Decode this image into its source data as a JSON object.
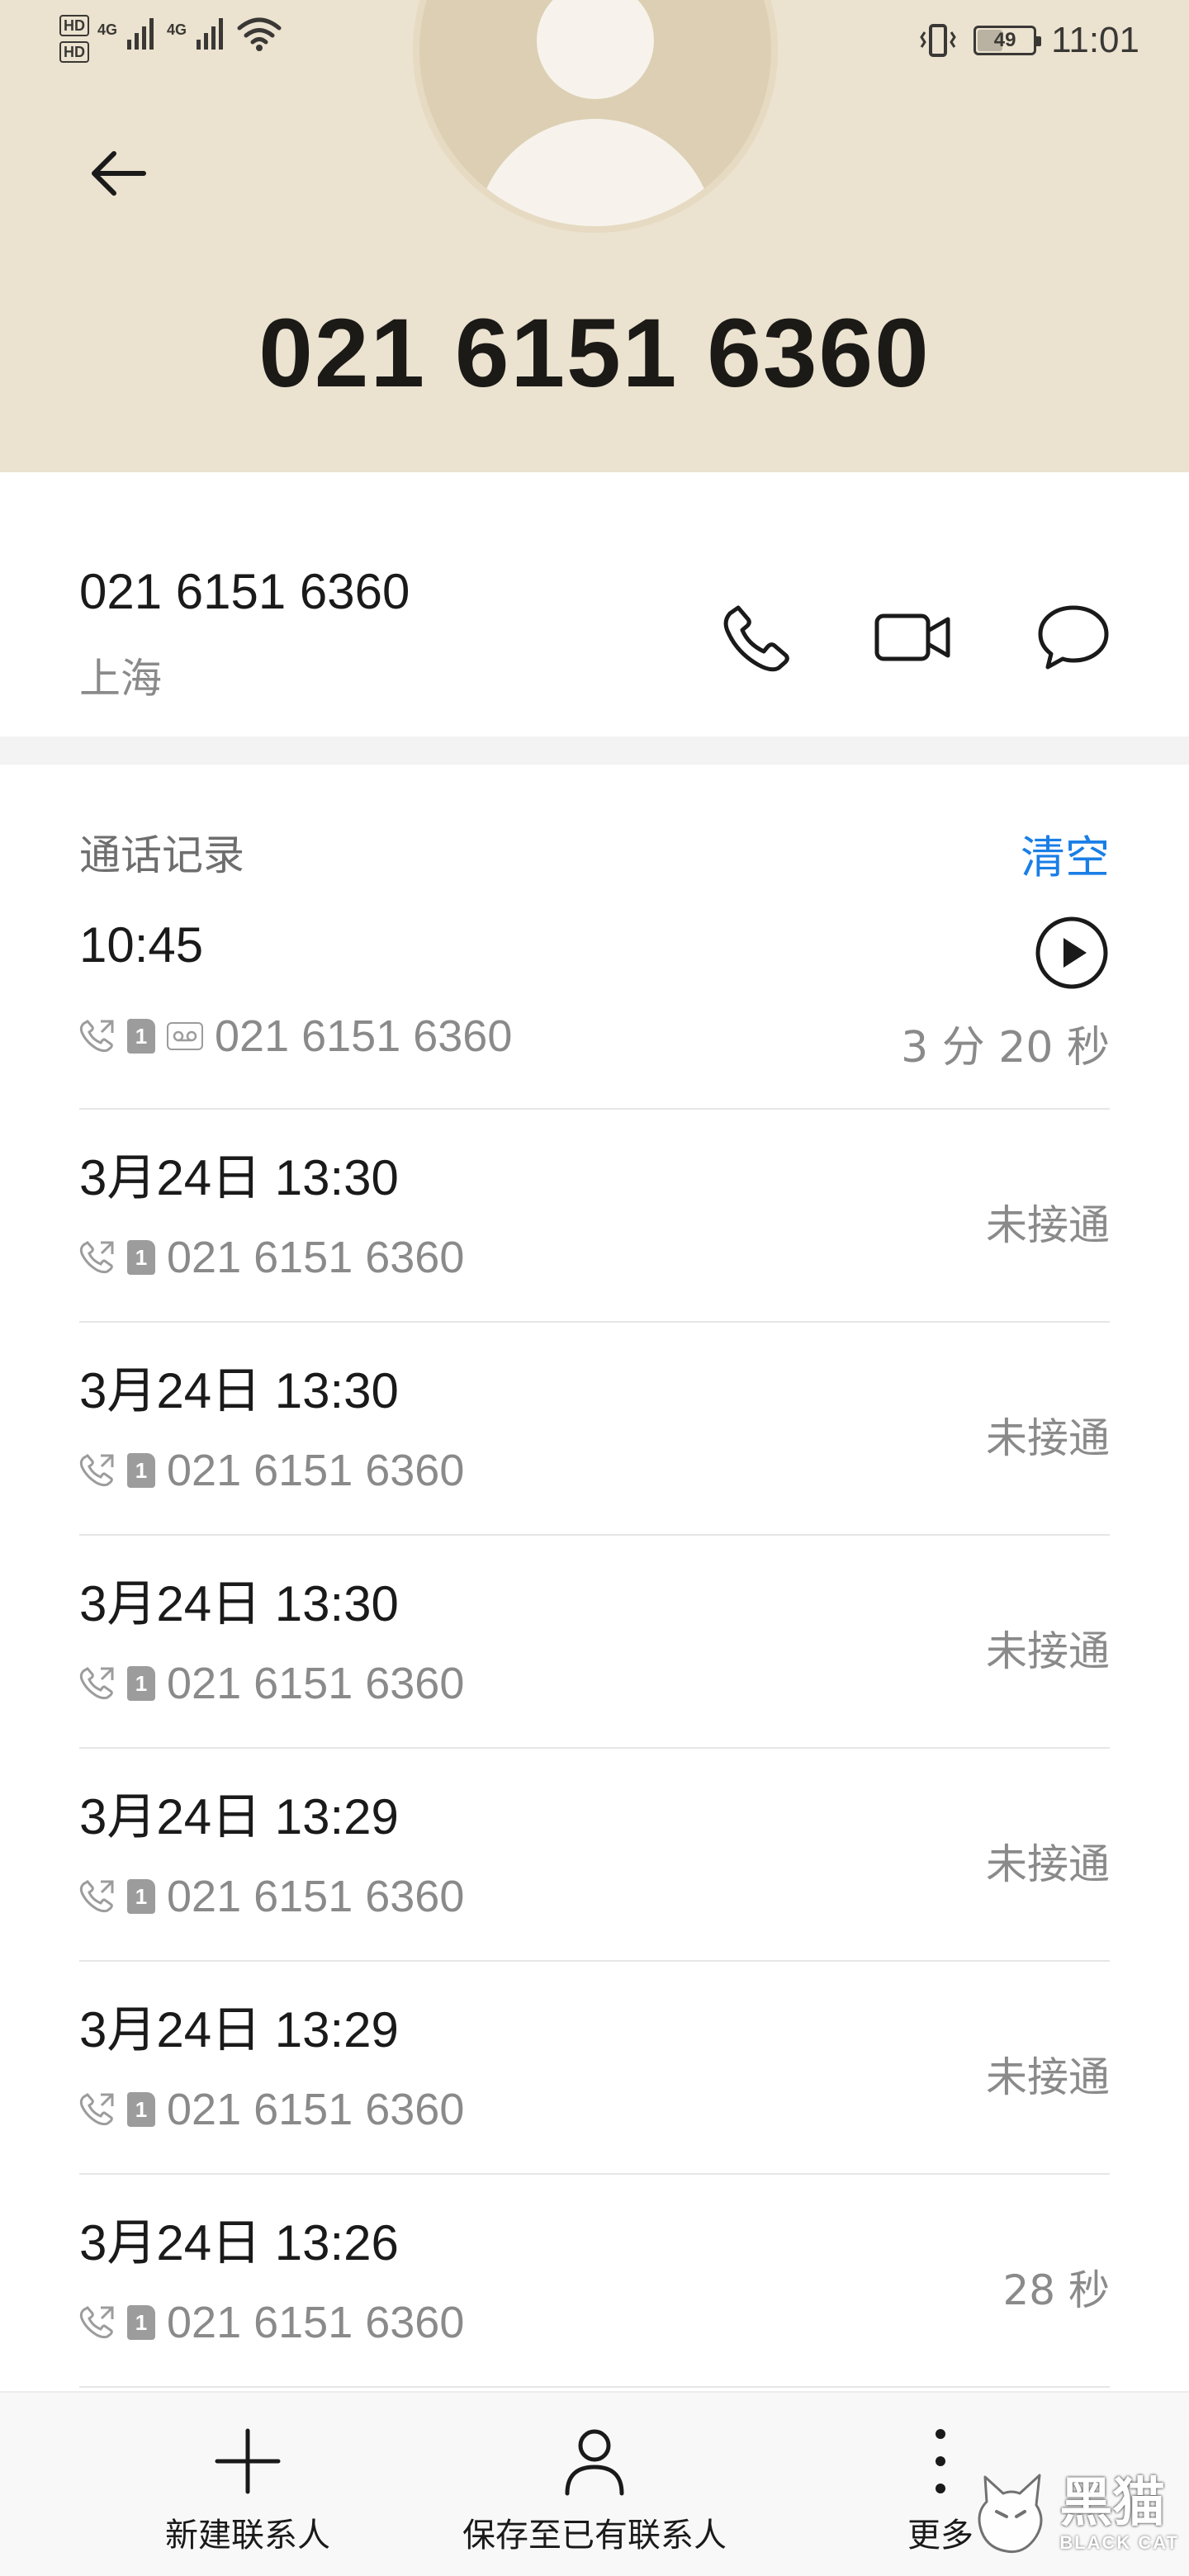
{
  "status_bar": {
    "hd1": "HD",
    "hd2": "HD",
    "network1": "4G",
    "network2": "4G",
    "battery": "49",
    "battery_fraction": 0.49,
    "time": "11:01"
  },
  "header": {
    "number": "021 6151 6360"
  },
  "contact": {
    "number": "021 6151 6360",
    "location": "上海"
  },
  "call_log": {
    "title": "通话记录",
    "clear_label": "清空",
    "entries": [
      {
        "time": "10:45",
        "number": "021 6151 6360",
        "sim": "1",
        "status": "",
        "duration": "3 分 20 秒",
        "voicemail": true
      },
      {
        "time": "3月24日 13:30",
        "number": "021 6151 6360",
        "sim": "1",
        "status": "未接通",
        "duration": "",
        "voicemail": false
      },
      {
        "time": "3月24日 13:30",
        "number": "021 6151 6360",
        "sim": "1",
        "status": "未接通",
        "duration": "",
        "voicemail": false
      },
      {
        "time": "3月24日 13:30",
        "number": "021 6151 6360",
        "sim": "1",
        "status": "未接通",
        "duration": "",
        "voicemail": false
      },
      {
        "time": "3月24日 13:29",
        "number": "021 6151 6360",
        "sim": "1",
        "status": "未接通",
        "duration": "",
        "voicemail": false
      },
      {
        "time": "3月24日 13:29",
        "number": "021 6151 6360",
        "sim": "1",
        "status": "未接通",
        "duration": "",
        "voicemail": false
      },
      {
        "time": "3月24日 13:26",
        "number": "021 6151 6360",
        "sim": "1",
        "status": "28 秒",
        "duration": "",
        "voicemail": false
      }
    ]
  },
  "bottom_bar": {
    "new_contact": "新建联系人",
    "save_existing": "保存至已有联系人",
    "more": "更多"
  },
  "watermark": {
    "title": "黑猫",
    "subtitle": "BLACK CAT"
  },
  "colors": {
    "header_bg": "#ebe2cf",
    "accent": "#1a7ee6",
    "secondary_text": "#8a8a8a"
  }
}
